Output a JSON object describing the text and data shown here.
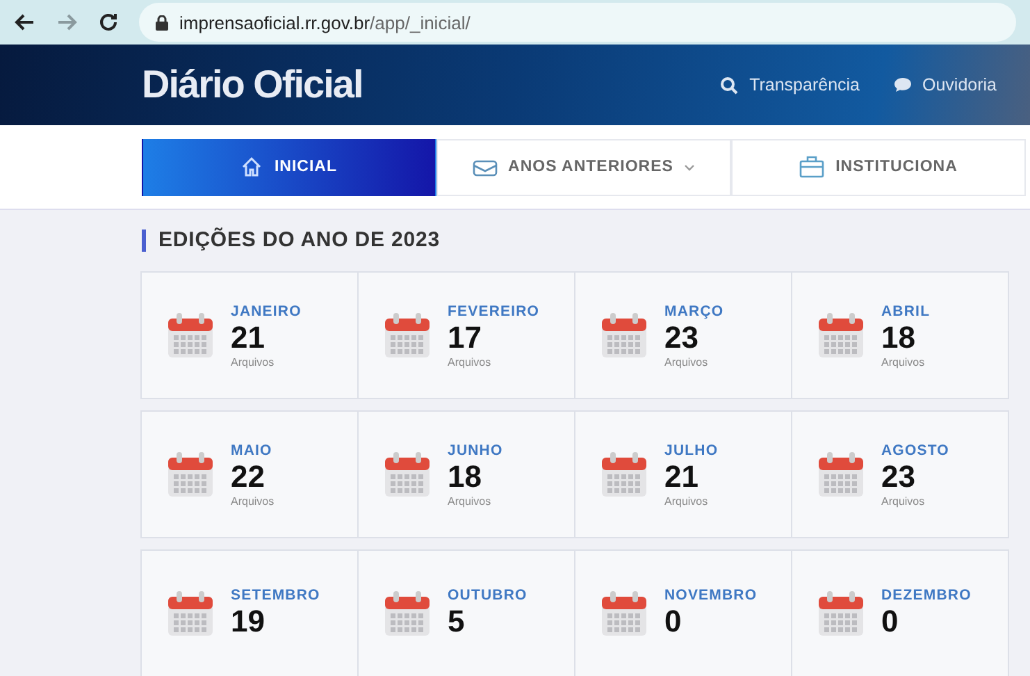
{
  "browser": {
    "url_host": "imprensaoficial.rr.gov.br",
    "url_path": "/app/_inicial/"
  },
  "header": {
    "title": "Diário Oficial",
    "links": [
      {
        "kind": "search",
        "label": "Transparência"
      },
      {
        "kind": "chat",
        "label": "Ouvidoria"
      }
    ]
  },
  "tabs": [
    {
      "kind": "home",
      "label": "INICIAL",
      "selected": true,
      "dropdown": false
    },
    {
      "kind": "mail",
      "label": "ANOS ANTERIORES",
      "selected": false,
      "dropdown": true
    },
    {
      "kind": "briefcase",
      "label": "INSTITUCIONA",
      "selected": false,
      "dropdown": false
    }
  ],
  "section_title": "EDIÇÕES DO ANO DE 2023",
  "months": [
    {
      "name": "JANEIRO",
      "count": "21",
      "unit": "Arquivos"
    },
    {
      "name": "FEVEREIRO",
      "count": "17",
      "unit": "Arquivos"
    },
    {
      "name": "MARÇO",
      "count": "23",
      "unit": "Arquivos"
    },
    {
      "name": "ABRIL",
      "count": "18",
      "unit": "Arquivos"
    },
    {
      "name": "MAIO",
      "count": "22",
      "unit": "Arquivos"
    },
    {
      "name": "JUNHO",
      "count": "18",
      "unit": "Arquivos"
    },
    {
      "name": "JULHO",
      "count": "21",
      "unit": "Arquivos"
    },
    {
      "name": "AGOSTO",
      "count": "23",
      "unit": "Arquivos"
    },
    {
      "name": "SETEMBRO",
      "count": "19"
    },
    {
      "name": "OUTUBRO",
      "count": "5"
    },
    {
      "name": "NOVEMBRO",
      "count": "0"
    },
    {
      "name": "DEZEMBRO",
      "count": "0"
    }
  ]
}
